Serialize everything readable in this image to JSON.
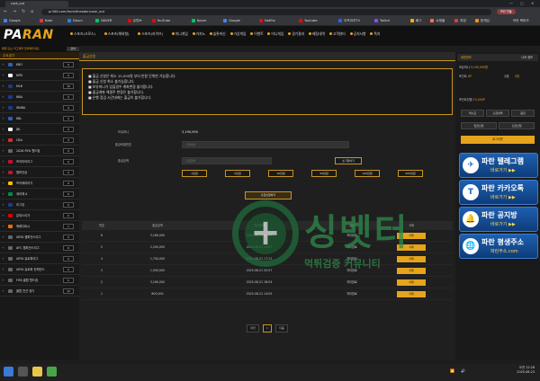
{
  "browser": {
    "tab_title": "cash_out",
    "url": "pr268.com/front#header/cash_out",
    "profile_label": "프린 만들"
  },
  "bookmarks": [
    {
      "label": "Google",
      "color": "#4285f4"
    },
    {
      "label": "Nate",
      "color": "#e53935"
    },
    {
      "label": "Daum",
      "color": "#1e88e5"
    },
    {
      "label": "NAVER",
      "color": "#03c75a"
    },
    {
      "label": "유튜브",
      "color": "#ff0000"
    },
    {
      "label": "YouTube",
      "color": "#ff0000"
    },
    {
      "label": "Naver",
      "color": "#03c75a"
    },
    {
      "label": "Google",
      "color": "#4285f4"
    },
    {
      "label": "Netflix",
      "color": "#e50914"
    },
    {
      "label": "Youtube",
      "color": "#ff0000"
    },
    {
      "label": "아프리카TV",
      "color": "#2962ff"
    },
    {
      "label": "Twitch",
      "color": "#9146ff"
    },
    {
      "label": "배그",
      "color": "#f5b000"
    },
    {
      "label": "쇼핑몰",
      "color": "#ff7043"
    },
    {
      "label": "피망",
      "color": "#e53935"
    },
    {
      "label": "한게임",
      "color": "#ff8f00"
    }
  ],
  "bookmarks_right": "모든 북마크",
  "site": {
    "logo_main": "PA",
    "logo_accent": "RAN",
    "nav": [
      "스포츠(크로스)",
      "스포츠(해외형)",
      "스포츠(라이브)",
      "미니게임",
      "카지노",
      "슬롯머신",
      "가상게임",
      "이벤트",
      "미니게임",
      "경기결과",
      "베팅내역",
      "고객센터",
      "공지사항",
      "쪽지"
    ],
    "notice_text": "발행 또는 리그명을 입력해주세요.",
    "notice_button": "검색"
  },
  "leftbar": {
    "header": "주요경기",
    "rows": [
      {
        "name": "KBO",
        "flag": "#2e5fb7",
        "count": "0"
      },
      {
        "name": "NPB",
        "flag": "#ffffff",
        "count": "0"
      },
      {
        "name": "MLB",
        "flag": "#1b3a8c",
        "count": "10"
      },
      {
        "name": "NBA",
        "flag": "#1b3a8c",
        "count": "0"
      },
      {
        "name": "WNBA",
        "flag": "#1b3a8c",
        "count": "0"
      },
      {
        "name": "KBL",
        "flag": "#2e5fb7",
        "count": "0"
      },
      {
        "name": "JBL",
        "flag": "#ffffff",
        "count": "0"
      },
      {
        "name": "CBA",
        "flag": "#d82b2b",
        "count": "0"
      },
      {
        "name": "2026 FIFA 월드컵",
        "flag": "#666666",
        "count": "0"
      },
      {
        "name": "프리미어리그",
        "flag": "#c8102e",
        "count": "0"
      },
      {
        "name": "챔피언십",
        "flag": "#c8102e",
        "count": "0"
      },
      {
        "name": "프리메라리가",
        "flag": "#f2c200",
        "count": "0"
      },
      {
        "name": "세리에 A",
        "flag": "#008c45",
        "count": "0"
      },
      {
        "name": "리그앙",
        "flag": "#1f3c88",
        "count": "0"
      },
      {
        "name": "분데스리가",
        "flag": "#dd0000",
        "count": "0"
      },
      {
        "name": "에레디비시",
        "flag": "#ff6a00",
        "count": "1"
      },
      {
        "name": "UEFA 챔피언스리그",
        "flag": "#666666",
        "count": "0"
      },
      {
        "name": "AFC 챔피언스리그",
        "flag": "#666666",
        "count": "0"
      },
      {
        "name": "UEFA 유로파리그",
        "flag": "#666666",
        "count": "0"
      },
      {
        "name": "UEFA 유로파 컨퍼런스",
        "flag": "#666666",
        "count": "0"
      },
      {
        "name": "FIFA 클럽 월드컵",
        "flag": "#666666",
        "count": "0"
      },
      {
        "name": "클럽 친선 경기",
        "flag": "#666666",
        "count": "12"
      }
    ]
  },
  "main": {
    "title": "출금신청",
    "notices": [
      "■ 출금 신청은 최소 10,000원 부터 만원 단위만 가능합니다.",
      "■ 출금 신청 취소 불가능합니다.",
      "■ 보유머니가 있을경우 계좌변경 불가합니다.",
      "■ 출금계좌 해결주 변경은 불가합니다.",
      "■ 은행 점검 시간대에는 출금이 불가합니다."
    ],
    "form": {
      "balance_label": "보유머니",
      "balance_value": "3,190,590",
      "password_label": "출금비밀번호",
      "password_placeholder": "출금비번",
      "amount_label": "출금금액",
      "amount_placeholder": "출금금액",
      "reset_label": "초기화하기",
      "amount_buttons": [
        "1만원",
        "5만원",
        "10만원",
        "50만원",
        "100만원",
        "500만원"
      ],
      "submit_label": "출금신청하기"
    },
    "table": {
      "headers": [
        "번호",
        "출금금액",
        "처리결과",
        "상태",
        "삭제"
      ],
      "rows": [
        {
          "no": "6",
          "amount": "3,180,000",
          "date": "2025-08-22 21:35",
          "status": "처리완료",
          "action": "삭제"
        },
        {
          "no": "5",
          "amount": "2,200,000",
          "date": "2025-08-22 19:27",
          "status": "처리완료",
          "action": "삭제"
        },
        {
          "no": "4",
          "amount": "1,700,000",
          "date": "2025-08-21 17:23",
          "status": "처리완료",
          "action": "삭제"
        },
        {
          "no": "3",
          "amount": "1,500,000",
          "date": "2025-08-21 20:57",
          "status": "처리완료",
          "action": "삭제"
        },
        {
          "no": "2",
          "amount": "3,160,000",
          "date": "2025-08-21 18:54",
          "status": "처리완료",
          "action": "삭제"
        },
        {
          "no": "1",
          "amount": "800,000",
          "date": "2025-08-21 14:05",
          "status": "처리완료",
          "action": "삭제"
        }
      ],
      "date_header": "처리결과"
    },
    "pager": {
      "prev": "이전",
      "page": "1",
      "next": "다음"
    }
  },
  "watermark": {
    "brand": "싱벳터",
    "subtitle": "먹튀검증 커뮤니티"
  },
  "rightbar": {
    "header_left": "회원정보",
    "header_right": "나의 정보",
    "money_label": "보유머니",
    "money_value": "3,190,590원",
    "point_label": "포인트",
    "point_value": "0P",
    "coupon_label": "쿠폰",
    "coupon_value": "0장",
    "point2_label": "포인트전환",
    "point2_value": "10,000P",
    "buttons_row1": [
      "캐시포",
      "출금내역",
      "충전"
    ],
    "buttons_row2": [
      "입금신청",
      "출금신청"
    ],
    "big_button": "로그아웃",
    "banners": [
      {
        "title": "파란 텔레그램",
        "sub": "바로가기 ▶▶",
        "icon": "✈"
      },
      {
        "title": "파란 카카오톡",
        "sub": "바로가기 ▶▶",
        "icon": "T"
      },
      {
        "title": "파란 공지방",
        "sub": "바로가기 ▶▶",
        "icon": "🔔"
      },
      {
        "title": "파란 평생주소",
        "sub": "파란주소.com",
        "icon": "🌐"
      }
    ]
  },
  "taskbar": {
    "time": "오전 12:28",
    "date": "2025-08-23"
  }
}
